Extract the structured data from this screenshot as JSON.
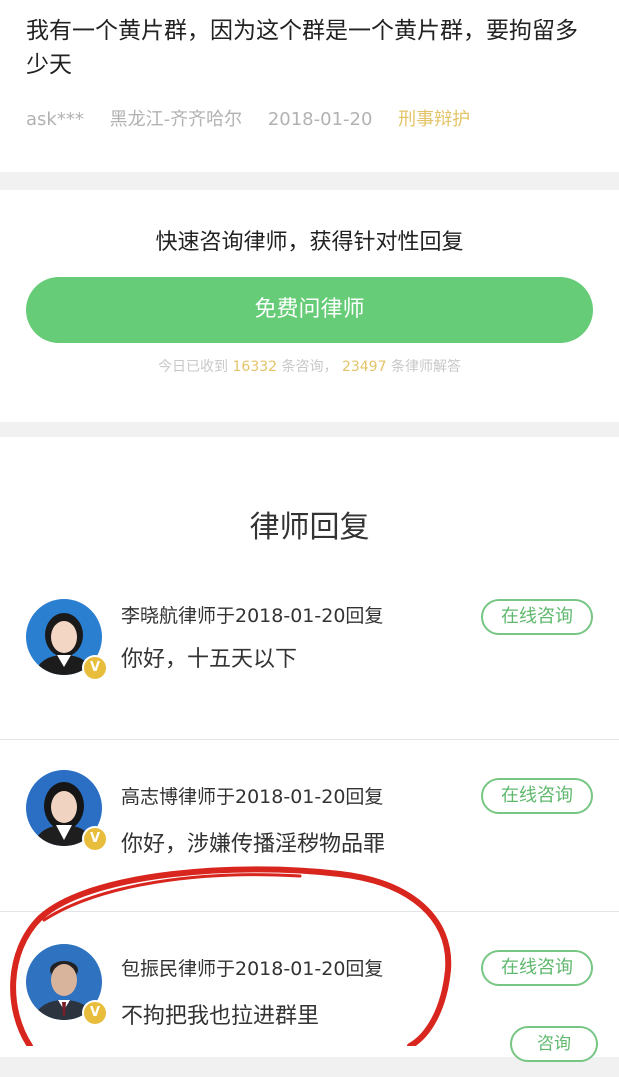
{
  "question": {
    "title": "我有一个黄片群，因为这个群是一个黄片群，要拘留多少天",
    "user": "ask***",
    "location": "黑龙江-齐齐哈尔",
    "date": "2018-01-20",
    "tag": "刑事辩护"
  },
  "cta": {
    "headline": "快速咨询律师，获得针对性回复",
    "button_label": "免费问律师",
    "stats_prefix": "今日已收到",
    "consult_count": "16332",
    "stats_middle": "条咨询，",
    "answer_count": "23497",
    "stats_suffix": "条律师解答"
  },
  "replies_section": {
    "title": "律师回复",
    "items": [
      {
        "byline": "李晓航律师于2018-01-20回复",
        "text": "你好，十五天以下",
        "button_label": "在线咨询",
        "avatar_icon": "lawyer-avatar-female"
      },
      {
        "byline": "高志博律师于2018-01-20回复",
        "text": "你好，涉嫌传播淫秽物品罪",
        "button_label": "在线咨询",
        "avatar_icon": "lawyer-avatar-female"
      },
      {
        "byline": "包振民律师于2018-01-20回复",
        "text": "不拘把我也拉进群里",
        "button_label": "在线咨询",
        "avatar_icon": "lawyer-avatar-male"
      }
    ],
    "partial_button_label": "咨询"
  },
  "colors": {
    "accent_green": "#66cc77",
    "highlight_gold": "#e3c468",
    "annotation_red": "#d8261f"
  }
}
